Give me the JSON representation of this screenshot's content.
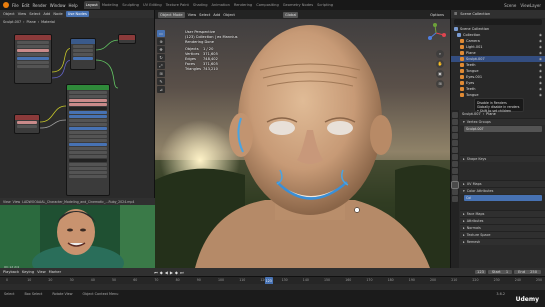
{
  "topbar": {
    "menu": [
      "File",
      "Edit",
      "Render",
      "Window",
      "Help"
    ],
    "tabs": [
      "Layout",
      "Modeling",
      "Sculpting",
      "UV Editing",
      "Texture Paint",
      "Shading",
      "Animation",
      "Rendering",
      "Compositing",
      "Geometry Nodes",
      "Scripting"
    ],
    "active_tab": "Layout",
    "scene": "Scene",
    "view_layer": "ViewLayer"
  },
  "node_editor": {
    "header": [
      "Object",
      "View",
      "Select",
      "Add",
      "Node",
      "Use Nodes"
    ],
    "breadcrumb": [
      "Sculpt.007",
      "Plane",
      "Material"
    ],
    "slot": "Slot 1"
  },
  "pip": {
    "header": [
      "View",
      "View",
      "Playback",
      "Marker"
    ],
    "filename": "LADWOOAAAL_Character_Modeling_and_Cinematic_...Ruby_2024.mp4",
    "caption": "OC 1d 2/4"
  },
  "viewport": {
    "mode": "Object Mode",
    "header": [
      "View",
      "Select",
      "Add",
      "Object"
    ],
    "transform": "Global",
    "options": "Options",
    "stats_header": [
      "User Perspective",
      "(123) Collection | ex Mannius",
      "Rendering Done"
    ],
    "stats": [
      {
        "k": "Objects",
        "v": "1 / 20"
      },
      {
        "k": "Vertices",
        "v": "371,605"
      },
      {
        "k": "Edges",
        "v": "748,402"
      },
      {
        "k": "Faces",
        "v": "371,605"
      },
      {
        "k": "Triangles",
        "v": "743,210"
      }
    ]
  },
  "outliner": {
    "title": "Scene Collection",
    "rows": [
      {
        "label": "Scene Collection",
        "indent": 3,
        "icon": "collection-icon"
      },
      {
        "label": "Collection",
        "indent": 6,
        "icon": "collection-icon"
      },
      {
        "label": "Camera",
        "indent": 9,
        "icon": "camera-icon"
      },
      {
        "label": "Light.001",
        "indent": 9,
        "icon": "light-icon"
      },
      {
        "label": "Plane",
        "indent": 9,
        "icon": "mesh-icon"
      },
      {
        "label": "Sculpt.007",
        "indent": 9,
        "icon": "mesh-icon",
        "selected": true
      },
      {
        "label": "Teeth",
        "indent": 9,
        "icon": "mesh-icon"
      },
      {
        "label": "Tongue",
        "indent": 9,
        "icon": "mesh-icon"
      },
      {
        "label": "Eyes.001",
        "indent": 9,
        "icon": "mesh-icon"
      },
      {
        "label": "Eyes",
        "indent": 9,
        "icon": "mesh-icon"
      },
      {
        "label": "Teeth",
        "indent": 9,
        "icon": "mesh-icon"
      },
      {
        "label": "Tongue",
        "indent": 9,
        "icon": "mesh-icon"
      }
    ]
  },
  "tooltip": {
    "lines": [
      "Disable in Renders",
      "Globally disable in renders",
      "• Shift to set children"
    ]
  },
  "properties": {
    "object": "Sculpt.007",
    "plane": "Plane",
    "sections": [
      "Vertex Groups",
      "Shape Keys",
      "UV Maps",
      "Color Attributes",
      "Face Maps",
      "Attributes",
      "Normals",
      "Texture Space",
      "Remesh"
    ],
    "fields": [
      "Sculpt.007",
      "Default",
      "Col"
    ]
  },
  "timeline": {
    "header": [
      "Playback",
      "Keying",
      "View",
      "Marker"
    ],
    "start_label": "Start",
    "start": "1",
    "end_label": "End",
    "end": "250",
    "current": "123",
    "ticks": [
      "0",
      "10",
      "20",
      "30",
      "40",
      "50",
      "60",
      "70",
      "80",
      "90",
      "100",
      "110",
      "120",
      "130",
      "140",
      "150",
      "160",
      "170",
      "180",
      "190",
      "200",
      "210",
      "220",
      "230",
      "240",
      "250"
    ]
  },
  "statusbar": {
    "items": [
      "Select",
      "Box Select",
      "Rotate View",
      "Object Context Menu"
    ],
    "version": "3.6.2"
  },
  "brand": "Udemy"
}
